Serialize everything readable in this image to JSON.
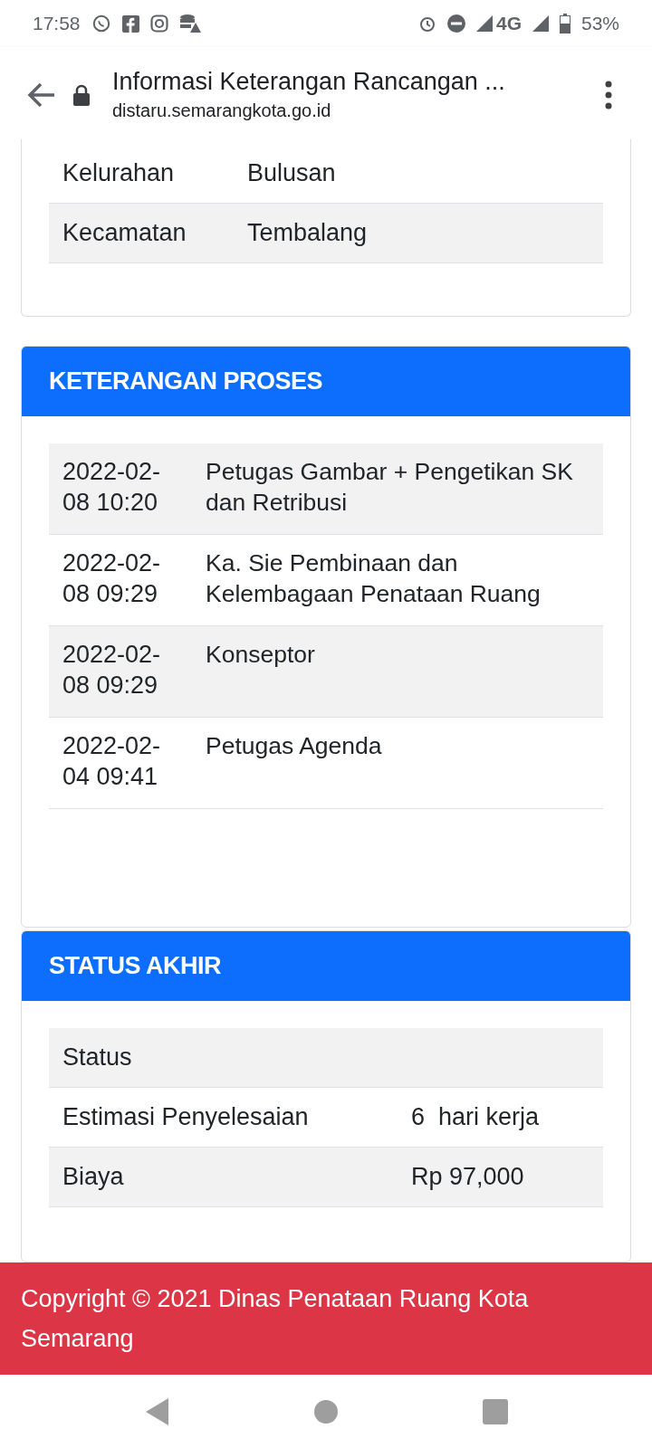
{
  "status_bar": {
    "time": "17:58",
    "battery": "53%",
    "network": "4G"
  },
  "browser": {
    "title": "Informasi Keterangan Rancangan ...",
    "url": "distaru.semarangkota.go.id"
  },
  "location_table": {
    "rows": [
      {
        "label": "Kelurahan",
        "value": "Bulusan"
      },
      {
        "label": "Kecamatan",
        "value": "Tembalang"
      }
    ]
  },
  "process_card": {
    "title": "KETERANGAN PROSES",
    "rows": [
      {
        "time": "2022-02-08 10:20",
        "description": "Petugas Gambar + Pengetikan SK dan Retribusi"
      },
      {
        "time": "2022-02-08 09:29",
        "description": "Ka. Sie Pembinaan dan Kelembagaan Penataan Ruang"
      },
      {
        "time": "2022-02-08 09:29",
        "description": "Konseptor"
      },
      {
        "time": "2022-02-04 09:41",
        "description": "Petugas Agenda"
      }
    ]
  },
  "final_status_card": {
    "title": "STATUS AKHIR",
    "rows": [
      {
        "label": "Status"
      },
      {
        "label": "Estimasi Penyelesaian",
        "value": "6  hari kerja"
      },
      {
        "label": "Biaya",
        "value": "Rp 97,000"
      }
    ]
  },
  "footer": {
    "text": "Copyright © 2021 Dinas Penataan Ruang Kota Semarang"
  }
}
